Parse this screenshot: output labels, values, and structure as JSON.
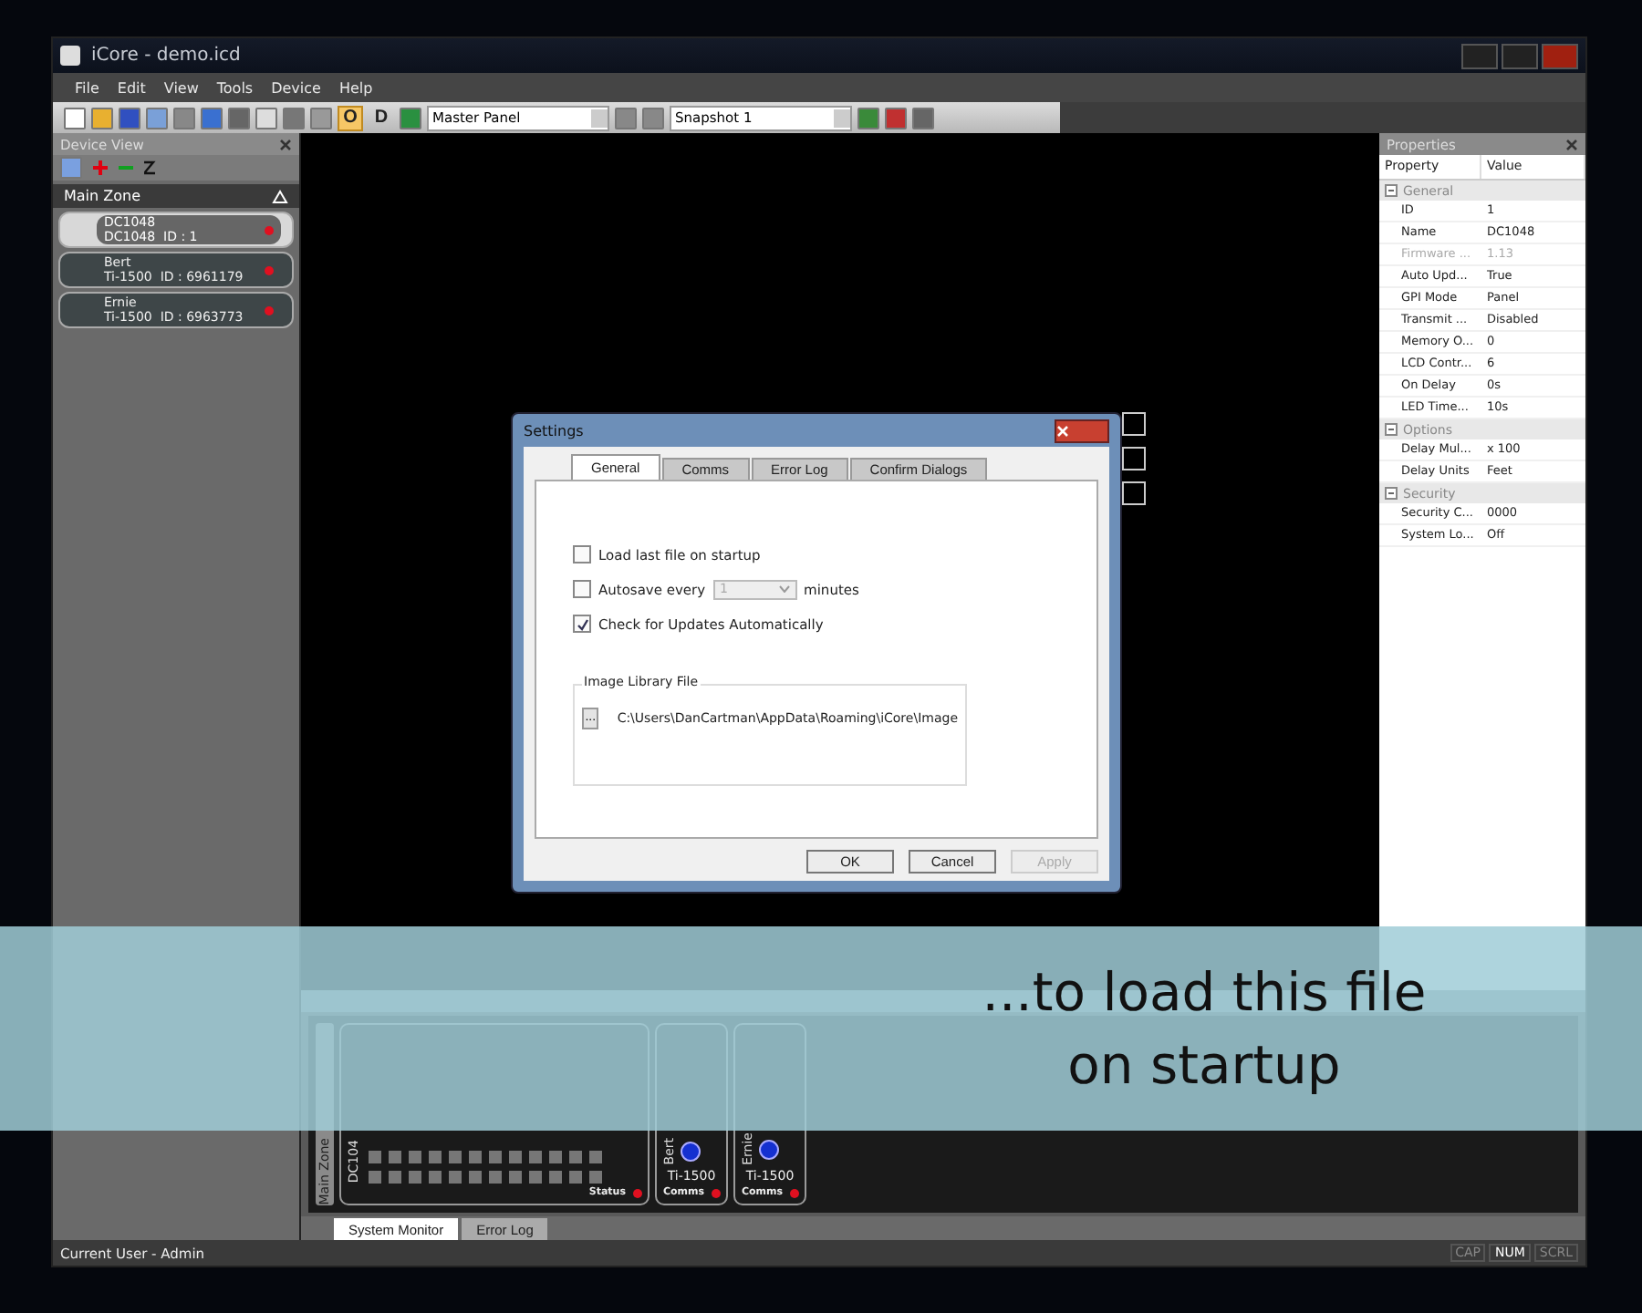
{
  "window": {
    "title": "iCore - demo.icd"
  },
  "menu": [
    "File",
    "Edit",
    "View",
    "Tools",
    "Device",
    "Help"
  ],
  "toolbar": {
    "toggles": [
      {
        "label": "O",
        "active": true
      },
      {
        "label": "D",
        "active": false
      }
    ],
    "panel_select": "Master Panel",
    "snapshot_select": "Snapshot 1"
  },
  "device_view": {
    "title": "Device View",
    "zone": "Main Zone",
    "devices": [
      {
        "name": "DC1048",
        "model": "DC1048",
        "id": "ID : 1",
        "selected": true
      },
      {
        "name": "Bert",
        "model": "Ti-1500",
        "id": "ID : 6961179",
        "selected": false
      },
      {
        "name": "Ernie",
        "model": "Ti-1500",
        "id": "ID : 6963773",
        "selected": false
      }
    ]
  },
  "properties": {
    "title": "Properties",
    "columns": [
      "Property",
      "Value"
    ],
    "groups": [
      {
        "name": "General",
        "rows": [
          {
            "property": "ID",
            "value": "1",
            "disabled": false
          },
          {
            "property": "Name",
            "value": "DC1048",
            "disabled": false
          },
          {
            "property": "Firmware ...",
            "value": "1.13",
            "disabled": true
          },
          {
            "property": "Auto Upd...",
            "value": "True",
            "disabled": false
          },
          {
            "property": "GPI Mode",
            "value": "Panel",
            "disabled": false
          },
          {
            "property": "Transmit ...",
            "value": "Disabled",
            "disabled": false
          },
          {
            "property": "Memory O...",
            "value": "0",
            "disabled": false
          },
          {
            "property": "LCD Contr...",
            "value": "6",
            "disabled": false
          },
          {
            "property": "On Delay",
            "value": "0s",
            "disabled": false
          },
          {
            "property": "LED Time...",
            "value": "10s",
            "disabled": false
          }
        ]
      },
      {
        "name": "Options",
        "rows": [
          {
            "property": "Delay Mul...",
            "value": "x 100",
            "disabled": false
          },
          {
            "property": "Delay Units",
            "value": "Feet",
            "disabled": false
          }
        ]
      },
      {
        "name": "Security",
        "rows": [
          {
            "property": "Security C...",
            "value": "0000",
            "disabled": false
          },
          {
            "property": "System Lo...",
            "value": "Off",
            "disabled": false
          }
        ]
      }
    ]
  },
  "monitor": {
    "zone_label": "Main Zone",
    "strips": [
      {
        "kind": "meters",
        "name": "DC104",
        "status_label": "Status"
      },
      {
        "kind": "fader",
        "name": "Bert",
        "model": "Ti-1500",
        "status_label": "Comms"
      },
      {
        "kind": "fader",
        "name": "Ernie",
        "model": "Ti-1500",
        "status_label": "Comms"
      }
    ],
    "tabs": [
      {
        "label": "System Monitor",
        "selected": true
      },
      {
        "label": "Error Log",
        "selected": false
      }
    ]
  },
  "status_bar": {
    "user": "Current User - Admin",
    "indicators": [
      {
        "label": "CAP",
        "on": false
      },
      {
        "label": "NUM",
        "on": true
      },
      {
        "label": "SCRL",
        "on": false
      }
    ]
  },
  "dialog": {
    "title": "Settings",
    "tabs": [
      {
        "label": "General",
        "selected": true
      },
      {
        "label": "Comms",
        "selected": false
      },
      {
        "label": "Error Log",
        "selected": false
      },
      {
        "label": "Confirm Dialogs",
        "selected": false
      }
    ],
    "options": [
      {
        "kind": "check",
        "label": "Load last file on startup",
        "checked": false
      },
      {
        "kind": "autosave",
        "label": "Autosave every",
        "checked": false,
        "value": "1",
        "value_disabled": true,
        "unit": "minutes"
      },
      {
        "kind": "check",
        "label": "Check for Updates Automatically",
        "checked": true
      }
    ],
    "library": {
      "title": "Image Library File",
      "button": "...",
      "path": "C:\\Users\\DanCartman\\AppData\\Roaming\\iCore\\Image"
    },
    "buttons": [
      {
        "label": "OK",
        "disabled": false
      },
      {
        "label": "Cancel",
        "disabled": false
      },
      {
        "label": "Apply",
        "disabled": true
      }
    ]
  },
  "caption": {
    "lines": [
      "...to load this file",
      "on startup"
    ]
  }
}
